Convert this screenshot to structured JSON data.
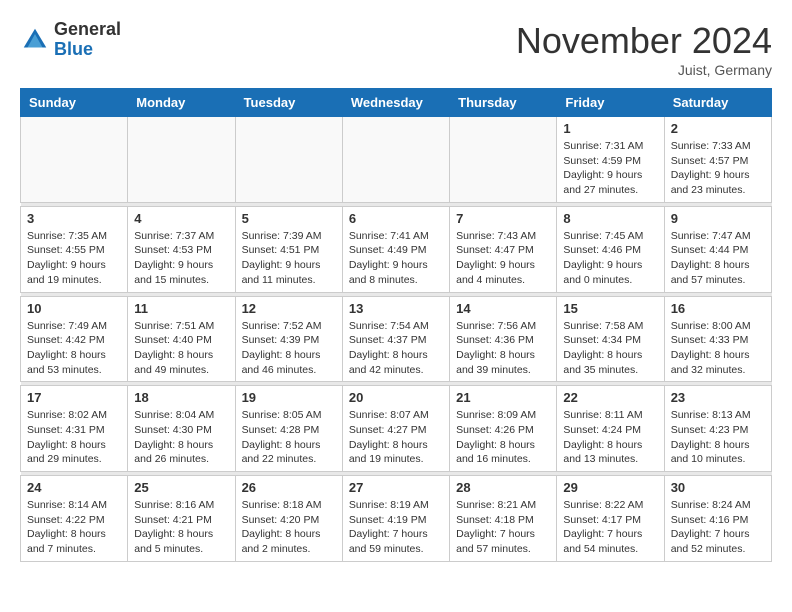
{
  "logo": {
    "general": "General",
    "blue": "Blue"
  },
  "title": "November 2024",
  "location": "Juist, Germany",
  "days_of_week": [
    "Sunday",
    "Monday",
    "Tuesday",
    "Wednesday",
    "Thursday",
    "Friday",
    "Saturday"
  ],
  "weeks": [
    [
      {
        "day": "",
        "info": ""
      },
      {
        "day": "",
        "info": ""
      },
      {
        "day": "",
        "info": ""
      },
      {
        "day": "",
        "info": ""
      },
      {
        "day": "",
        "info": ""
      },
      {
        "day": "1",
        "info": "Sunrise: 7:31 AM\nSunset: 4:59 PM\nDaylight: 9 hours\nand 27 minutes."
      },
      {
        "day": "2",
        "info": "Sunrise: 7:33 AM\nSunset: 4:57 PM\nDaylight: 9 hours\nand 23 minutes."
      }
    ],
    [
      {
        "day": "3",
        "info": "Sunrise: 7:35 AM\nSunset: 4:55 PM\nDaylight: 9 hours\nand 19 minutes."
      },
      {
        "day": "4",
        "info": "Sunrise: 7:37 AM\nSunset: 4:53 PM\nDaylight: 9 hours\nand 15 minutes."
      },
      {
        "day": "5",
        "info": "Sunrise: 7:39 AM\nSunset: 4:51 PM\nDaylight: 9 hours\nand 11 minutes."
      },
      {
        "day": "6",
        "info": "Sunrise: 7:41 AM\nSunset: 4:49 PM\nDaylight: 9 hours\nand 8 minutes."
      },
      {
        "day": "7",
        "info": "Sunrise: 7:43 AM\nSunset: 4:47 PM\nDaylight: 9 hours\nand 4 minutes."
      },
      {
        "day": "8",
        "info": "Sunrise: 7:45 AM\nSunset: 4:46 PM\nDaylight: 9 hours\nand 0 minutes."
      },
      {
        "day": "9",
        "info": "Sunrise: 7:47 AM\nSunset: 4:44 PM\nDaylight: 8 hours\nand 57 minutes."
      }
    ],
    [
      {
        "day": "10",
        "info": "Sunrise: 7:49 AM\nSunset: 4:42 PM\nDaylight: 8 hours\nand 53 minutes."
      },
      {
        "day": "11",
        "info": "Sunrise: 7:51 AM\nSunset: 4:40 PM\nDaylight: 8 hours\nand 49 minutes."
      },
      {
        "day": "12",
        "info": "Sunrise: 7:52 AM\nSunset: 4:39 PM\nDaylight: 8 hours\nand 46 minutes."
      },
      {
        "day": "13",
        "info": "Sunrise: 7:54 AM\nSunset: 4:37 PM\nDaylight: 8 hours\nand 42 minutes."
      },
      {
        "day": "14",
        "info": "Sunrise: 7:56 AM\nSunset: 4:36 PM\nDaylight: 8 hours\nand 39 minutes."
      },
      {
        "day": "15",
        "info": "Sunrise: 7:58 AM\nSunset: 4:34 PM\nDaylight: 8 hours\nand 35 minutes."
      },
      {
        "day": "16",
        "info": "Sunrise: 8:00 AM\nSunset: 4:33 PM\nDaylight: 8 hours\nand 32 minutes."
      }
    ],
    [
      {
        "day": "17",
        "info": "Sunrise: 8:02 AM\nSunset: 4:31 PM\nDaylight: 8 hours\nand 29 minutes."
      },
      {
        "day": "18",
        "info": "Sunrise: 8:04 AM\nSunset: 4:30 PM\nDaylight: 8 hours\nand 26 minutes."
      },
      {
        "day": "19",
        "info": "Sunrise: 8:05 AM\nSunset: 4:28 PM\nDaylight: 8 hours\nand 22 minutes."
      },
      {
        "day": "20",
        "info": "Sunrise: 8:07 AM\nSunset: 4:27 PM\nDaylight: 8 hours\nand 19 minutes."
      },
      {
        "day": "21",
        "info": "Sunrise: 8:09 AM\nSunset: 4:26 PM\nDaylight: 8 hours\nand 16 minutes."
      },
      {
        "day": "22",
        "info": "Sunrise: 8:11 AM\nSunset: 4:24 PM\nDaylight: 8 hours\nand 13 minutes."
      },
      {
        "day": "23",
        "info": "Sunrise: 8:13 AM\nSunset: 4:23 PM\nDaylight: 8 hours\nand 10 minutes."
      }
    ],
    [
      {
        "day": "24",
        "info": "Sunrise: 8:14 AM\nSunset: 4:22 PM\nDaylight: 8 hours\nand 7 minutes."
      },
      {
        "day": "25",
        "info": "Sunrise: 8:16 AM\nSunset: 4:21 PM\nDaylight: 8 hours\nand 5 minutes."
      },
      {
        "day": "26",
        "info": "Sunrise: 8:18 AM\nSunset: 4:20 PM\nDaylight: 8 hours\nand 2 minutes."
      },
      {
        "day": "27",
        "info": "Sunrise: 8:19 AM\nSunset: 4:19 PM\nDaylight: 7 hours\nand 59 minutes."
      },
      {
        "day": "28",
        "info": "Sunrise: 8:21 AM\nSunset: 4:18 PM\nDaylight: 7 hours\nand 57 minutes."
      },
      {
        "day": "29",
        "info": "Sunrise: 8:22 AM\nSunset: 4:17 PM\nDaylight: 7 hours\nand 54 minutes."
      },
      {
        "day": "30",
        "info": "Sunrise: 8:24 AM\nSunset: 4:16 PM\nDaylight: 7 hours\nand 52 minutes."
      }
    ]
  ]
}
